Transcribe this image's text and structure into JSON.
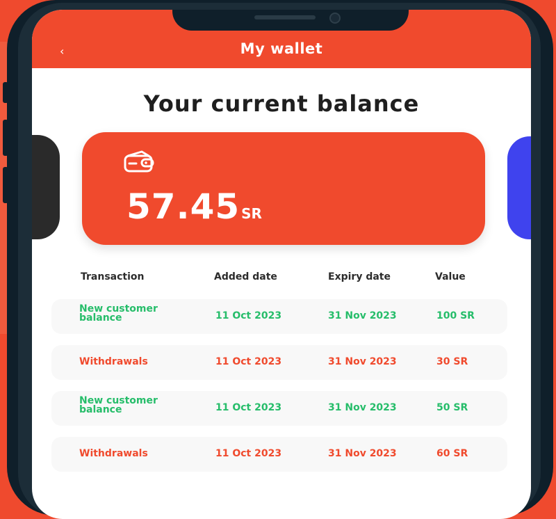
{
  "header": {
    "back_icon": "chevron-left-icon",
    "back_glyph": "‹",
    "title": "My wallet"
  },
  "page": {
    "heading": "Your current balance"
  },
  "balance_card": {
    "amount": "57.45",
    "currency": "SR",
    "icon": "wallet-icon"
  },
  "table": {
    "headers": [
      "Transaction",
      "Added date",
      "Expiry date",
      "Value"
    ],
    "rows": [
      {
        "transaction": "New customer balance",
        "added": "11 Oct 2023",
        "expiry": "31 Nov 2023",
        "value": "100 SR",
        "type": "credit"
      },
      {
        "transaction": "Withdrawals",
        "added": "11 Oct 2023",
        "expiry": "31 Nov 2023",
        "value": "30 SR",
        "type": "debit"
      },
      {
        "transaction": "New customer balance",
        "added": "11 Oct 2023",
        "expiry": "31 Nov 2023",
        "value": "50 SR",
        "type": "credit"
      },
      {
        "transaction": "Withdrawals",
        "added": "11 Oct 2023",
        "expiry": "31 Nov 2023",
        "value": "60 SR",
        "type": "debit"
      }
    ]
  },
  "colors": {
    "accent": "#f04a2d",
    "credit": "#26bd6a",
    "debit": "#f04a2d",
    "card_right": "#3f43ee",
    "card_left": "#2a2a2a"
  }
}
